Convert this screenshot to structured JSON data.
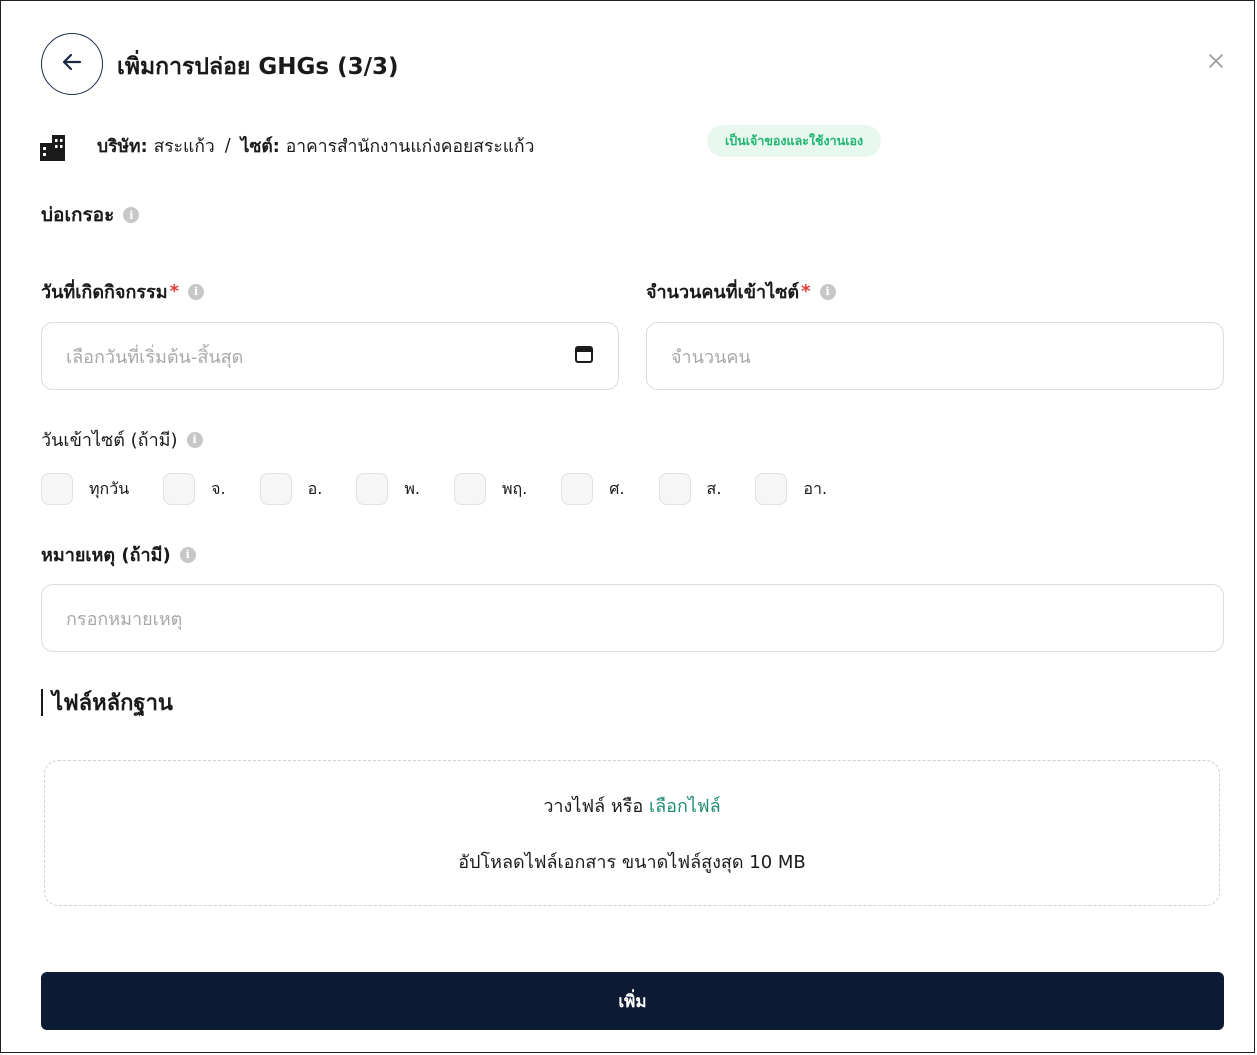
{
  "header": {
    "title": "เพิ่มการปล่อย GHGs (3/3)"
  },
  "company": {
    "company_label": "บริษัท:",
    "company_name": "สระแก้ว",
    "separator": "/",
    "site_label": "ไซต์:",
    "site_name": "อาคารสำนักงานแก่งคอยสระแก้ว",
    "badge": "เป็นเจ้าของและใช้งานเอง"
  },
  "section": {
    "title": "บ่อเกรอะ",
    "info_glyph": "i"
  },
  "fields": {
    "activity_date": {
      "label": "วันที่เกิดกิจกรรม",
      "required_mark": "*",
      "placeholder": "เลือกวันที่เริ่มต้น-สิ้นสุด"
    },
    "people_count": {
      "label": "จำนวนคนที่เข้าไซต์",
      "required_mark": "*",
      "placeholder": "จำนวนคน"
    },
    "visit_days": {
      "label": "วันเข้าไซต์ (ถ้ามี)",
      "options": [
        "ทุกวัน",
        "จ.",
        "อ.",
        "พ.",
        "พฤ.",
        "ศ.",
        "ส.",
        "อา."
      ]
    },
    "note": {
      "label": "หมายเหตุ (ถ้ามี)",
      "placeholder": "กรอกหมายเหตุ"
    }
  },
  "evidence": {
    "title": "ไฟล์หลักฐาน",
    "drop_text": "วางไฟล์ หรือ",
    "choose_link": "เลือกไฟล์",
    "hint": "อัปโหลดไฟล์เอกสาร ขนาดไฟล์สูงสุด 10 MB"
  },
  "submit_label": "เพิ่ม",
  "icons": {
    "back": "arrow-left-icon",
    "close": "close-icon",
    "building": "building-icon",
    "info": "info-icon",
    "calendar": "calendar-icon"
  },
  "colors": {
    "primary": "#0c1b33",
    "badge_bg": "#e8f8ef",
    "badge_text": "#20b672",
    "link": "#1f8c72",
    "required": "#e23b3b"
  }
}
